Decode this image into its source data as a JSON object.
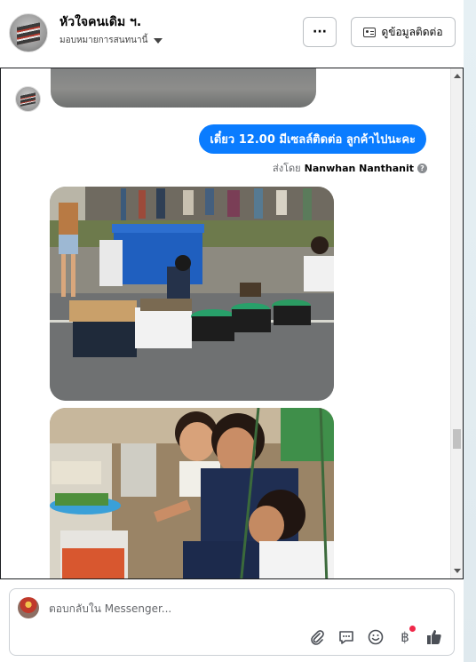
{
  "header": {
    "page_name": "หัวใจคนเดิม ฯ.",
    "assigned_to": "มอบหมายการสนทนานี้",
    "more_label": "···",
    "contact_info_label": "ดูข้อมูลติดต่อ"
  },
  "conversation": {
    "outgoing_message": "เดี๋ยว 12.00 มีเซลล์ติดต่อ ลูกค้าไปนะคะ",
    "sent_by_label": "ส่งโดย",
    "sender_name": "Nanwhan Nanthanit",
    "help_glyph": "?"
  },
  "composer": {
    "placeholder": "ตอบกลับใน Messenger...",
    "value": "",
    "payment_glyph": "฿",
    "tool_icons": [
      "attachment-icon",
      "saved-replies-icon",
      "emoji-icon",
      "payment-icon",
      "like-icon"
    ]
  },
  "colors": {
    "bubble": "#0a7cff",
    "border": "#1c1e21",
    "notification_dot": "#f02849"
  }
}
